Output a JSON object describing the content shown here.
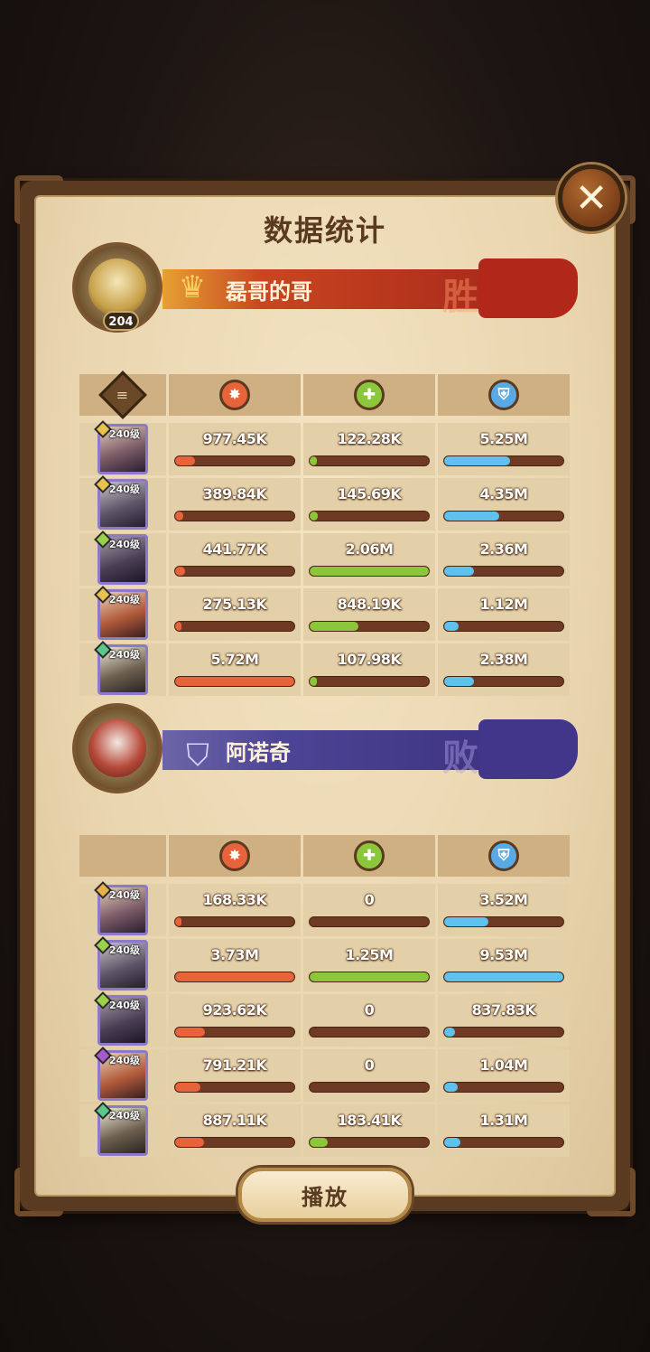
{
  "window": {
    "title": "数据统计",
    "close_label": "✕"
  },
  "team_a": {
    "name": "磊哥的哥",
    "result": "胜",
    "avatar_level": "204",
    "emblem": "crown-emblem"
  },
  "team_b": {
    "name": "阿诺奇",
    "result": "败",
    "emblem": "banner-shield-emblem"
  },
  "columns": {
    "hero": "doc-icon",
    "damage": "damage-icon",
    "heal": "heal-icon",
    "shield": "shield-icon"
  },
  "colors": {
    "damage": "#e7633a",
    "heal": "#8cc63a",
    "shield": "#5fc1ee",
    "win": "#b1281b",
    "lose": "#41368a"
  },
  "team_a_rows": [
    {
      "level": "240级",
      "gem": "#e8c24a",
      "damage": "977.45K",
      "damage_pct": 0.17,
      "heal": "122.28K",
      "heal_pct": 0.06,
      "shield": "5.25M",
      "shield_pct": 0.55
    },
    {
      "level": "240级",
      "gem": "#e8c24a",
      "damage": "389.84K",
      "damage_pct": 0.07,
      "heal": "145.69K",
      "heal_pct": 0.07,
      "shield": "4.35M",
      "shield_pct": 0.46
    },
    {
      "level": "240级",
      "gem": "#9ad04a",
      "damage": "441.77K",
      "damage_pct": 0.08,
      "heal": "2.06M",
      "heal_pct": 1.0,
      "shield": "2.36M",
      "shield_pct": 0.25
    },
    {
      "level": "240级",
      "gem": "#e8c24a",
      "damage": "275.13K",
      "damage_pct": 0.05,
      "heal": "848.19K",
      "heal_pct": 0.41,
      "shield": "1.12M",
      "shield_pct": 0.12
    },
    {
      "level": "240级",
      "gem": "#5ac88a",
      "damage": "5.72M",
      "damage_pct": 1.0,
      "heal": "107.98K",
      "heal_pct": 0.05,
      "shield": "2.38M",
      "shield_pct": 0.25
    }
  ],
  "team_b_rows": [
    {
      "level": "240级",
      "gem": "#e8b04a",
      "damage": "168.33K",
      "damage_pct": 0.05,
      "heal": "0",
      "heal_pct": 0.0,
      "shield": "3.52M",
      "shield_pct": 0.37
    },
    {
      "level": "240级",
      "gem": "#9ad04a",
      "damage": "3.73M",
      "damage_pct": 1.0,
      "heal": "1.25M",
      "heal_pct": 1.0,
      "shield": "9.53M",
      "shield_pct": 1.0
    },
    {
      "level": "240级",
      "gem": "#9ad04a",
      "damage": "923.62K",
      "damage_pct": 0.25,
      "heal": "0",
      "heal_pct": 0.0,
      "shield": "837.83K",
      "shield_pct": 0.09
    },
    {
      "level": "240级",
      "gem": "#a65ad0",
      "damage": "791.21K",
      "damage_pct": 0.21,
      "heal": "0",
      "heal_pct": 0.0,
      "shield": "1.04M",
      "shield_pct": 0.11
    },
    {
      "level": "240级",
      "gem": "#5ac88a",
      "damage": "887.11K",
      "damage_pct": 0.24,
      "heal": "183.41K",
      "heal_pct": 0.15,
      "shield": "1.31M",
      "shield_pct": 0.14
    }
  ],
  "footer": {
    "play_label": "播放"
  }
}
